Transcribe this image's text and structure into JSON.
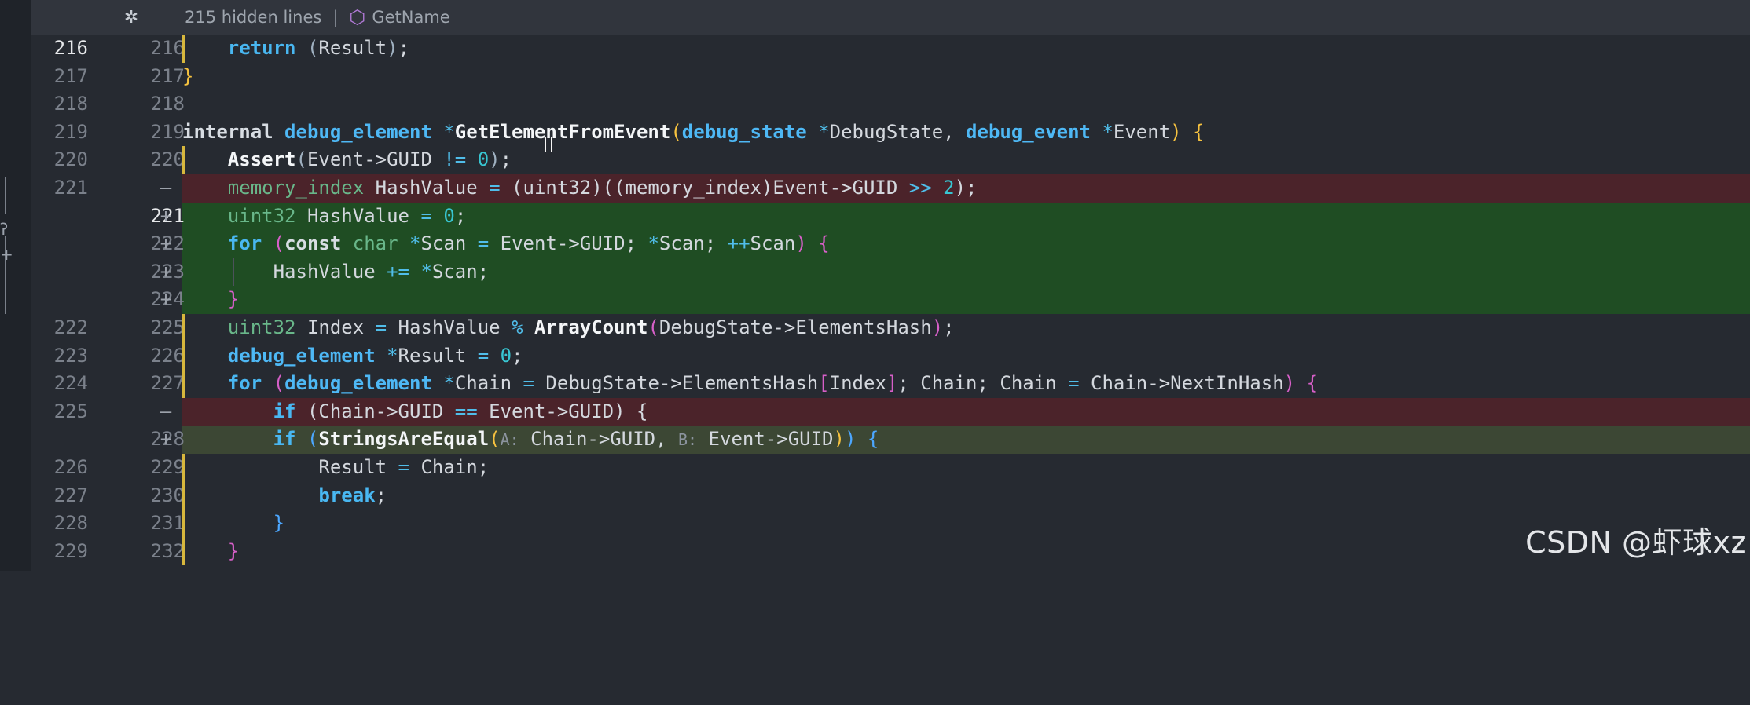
{
  "header": {
    "fold_icon": "fold-icon",
    "hidden_lines": "215 hidden lines",
    "separator": "|",
    "context_icon": "cube-icon",
    "context_name": "GetName"
  },
  "watermark": "CSDN @虾球xz",
  "colors": {
    "background": "#262a31",
    "removed_bg": "#4b232a",
    "added_bg": "#1f4d23",
    "added_soft_bg": "#3c4734",
    "gutter_accent": "#d7b73d"
  },
  "lines": [
    {
      "old": "216",
      "new": "216",
      "marker": "",
      "text": "    return (Result);"
    },
    {
      "old": "217",
      "new": "217",
      "marker": "",
      "text": "}"
    },
    {
      "old": "218",
      "new": "218",
      "marker": "",
      "text": ""
    },
    {
      "old": "219",
      "new": "219",
      "marker": "",
      "text": "internal debug_element *GetElementFromEvent(debug_state *DebugState, debug_event *Event) {"
    },
    {
      "old": "220",
      "new": "220",
      "marker": "",
      "text": "    Assert(Event->GUID != 0);"
    },
    {
      "old": "221",
      "new": "",
      "marker": "—",
      "text": "    memory_index HashValue = (uint32)((memory_index)Event->GUID >> 2);"
    },
    {
      "old": "",
      "new": "221",
      "marker": "+",
      "text": "    uint32 HashValue = 0;"
    },
    {
      "old": "",
      "new": "222",
      "marker": "+",
      "text": "    for (const char *Scan = Event->GUID; *Scan; ++Scan) {"
    },
    {
      "old": "",
      "new": "223",
      "marker": "+",
      "text": "        HashValue += *Scan;"
    },
    {
      "old": "",
      "new": "224",
      "marker": "+",
      "text": "    }"
    },
    {
      "old": "222",
      "new": "225",
      "marker": "",
      "text": "    uint32 Index = HashValue % ArrayCount(DebugState->ElementsHash);"
    },
    {
      "old": "223",
      "new": "226",
      "marker": "",
      "text": "    debug_element *Result = 0;"
    },
    {
      "old": "224",
      "new": "227",
      "marker": "",
      "text": "    for (debug_element *Chain = DebugState->ElementsHash[Index]; Chain; Chain = Chain->NextInHash) {"
    },
    {
      "old": "225",
      "new": "",
      "marker": "—",
      "text": "        if (Chain->GUID == Event->GUID) {"
    },
    {
      "old": "",
      "new": "228",
      "marker": "+",
      "text": "        if (StringsAreEqual(A: Chain->GUID, B: Event->GUID)) {"
    },
    {
      "old": "226",
      "new": "229",
      "marker": "",
      "text": "            Result = Chain;"
    },
    {
      "old": "227",
      "new": "230",
      "marker": "",
      "text": "            break;"
    },
    {
      "old": "228",
      "new": "231",
      "marker": "",
      "text": "        }"
    },
    {
      "old": "229",
      "new": "232",
      "marker": "",
      "text": "    }"
    }
  ]
}
